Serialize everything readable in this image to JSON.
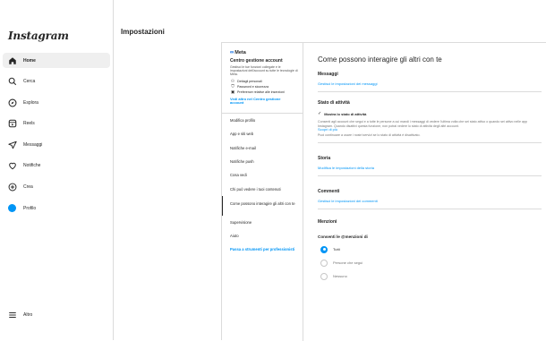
{
  "app": {
    "logo": "Instagram"
  },
  "sidebar": {
    "items": [
      {
        "label": "Home",
        "icon": "home-icon",
        "active": true
      },
      {
        "label": "Cerca",
        "icon": "search-icon"
      },
      {
        "label": "Esplora",
        "icon": "compass-icon"
      },
      {
        "label": "Reels",
        "icon": "reels-icon"
      },
      {
        "label": "Messaggi",
        "icon": "send-icon"
      },
      {
        "label": "Notifiche",
        "icon": "heart-icon"
      },
      {
        "label": "Crea",
        "icon": "plus-icon"
      },
      {
        "label": "Profilo",
        "icon": "avatar"
      }
    ],
    "more": "Altro"
  },
  "header": {
    "title": "Impostazioni"
  },
  "meta": {
    "logo": "Meta",
    "title": "Centro gestione account",
    "desc": "Gestisci le tue funzioni collegate e le impostazioni dell'account su tutte le tecnologie di Meta.",
    "items": [
      {
        "icon": "person-icon",
        "label": "Dettagli personali"
      },
      {
        "icon": "shield-icon",
        "label": "Password e sicurezza"
      },
      {
        "icon": "ad-icon",
        "label": "Preferenze relative alle inserzioni"
      }
    ],
    "link": "Vedi altro nel Centro gestione account"
  },
  "menu": {
    "items": [
      {
        "label": "Modifica profilo"
      },
      {
        "label": "App e siti web"
      },
      {
        "label": "Notifiche e-mail"
      },
      {
        "label": "Notifiche push"
      },
      {
        "label": "Cosa vedi"
      },
      {
        "label": "Chi può vedere i tuoi contenuti"
      },
      {
        "label": "Come possono interagire gli altri con te",
        "active": true
      },
      {
        "label": "Supervisione"
      },
      {
        "label": "Aiuto"
      }
    ],
    "switch_link": "Passa a strumenti per professionisti"
  },
  "content": {
    "title": "Come possono interagire gli altri con te",
    "messaggi": {
      "title": "Messaggi",
      "link": "Gestisci le impostazioni dei messaggi"
    },
    "stato": {
      "title": "Stato di attività",
      "checkbox": "Mostra lo stato di attività",
      "desc": "Consenti agli account che segui e a tutte le persone a cui mandi i messaggi di vedere l'ultima volta che sei stato attivo o quando sei attivo nelle app Instagram. Quando disattivi questa funzione, non potrai vedere lo stato di attività degli altri account.",
      "learn_more": "Scopri di più",
      "desc2": "Puoi continuare a usare i nostri servizi se lo stato di attività è disattivato."
    },
    "storia": {
      "title": "Storia",
      "link": "Modifica le impostazioni della storia"
    },
    "commenti": {
      "title": "Commenti",
      "link": "Gestisci le impostazioni dei commenti"
    },
    "menzioni": {
      "title": "Menzioni",
      "subtitle": "Consenti le @menzioni di",
      "options": [
        {
          "label": "Tutti",
          "selected": true
        },
        {
          "label": "Persone che segui",
          "selected": false
        },
        {
          "label": "Nessuno",
          "selected": false
        }
      ]
    }
  },
  "colors": {
    "accent": "#0095f6",
    "border": "#dbdbdb",
    "text": "#262626",
    "muted": "#737373"
  }
}
